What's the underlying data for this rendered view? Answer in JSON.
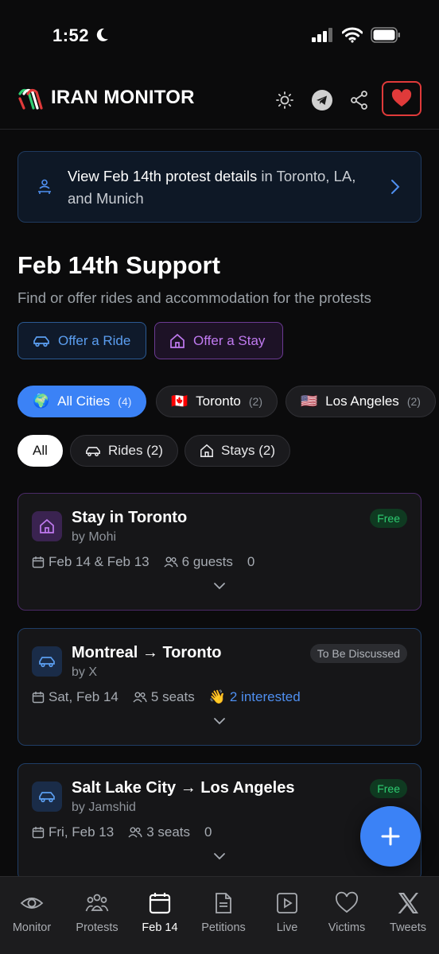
{
  "status_bar": {
    "time": "1:52"
  },
  "header": {
    "app_title": "IRAN MONITOR",
    "icons": [
      "sun-icon",
      "telegram-icon",
      "share-icon",
      "heart-icon"
    ]
  },
  "banner": {
    "bold": "View Feb 14th protest details",
    "rest": " in Toronto, LA, and Munich"
  },
  "page": {
    "title": "Feb 14th Support",
    "subtitle": "Find or offer rides and accommodation for the protests"
  },
  "actions": {
    "offer_ride": "Offer a Ride",
    "offer_stay": "Offer a Stay"
  },
  "city_filters": [
    {
      "flag": "🌍",
      "label": "All Cities",
      "count": "(4)",
      "active": true
    },
    {
      "flag": "🇨🇦",
      "label": "Toronto",
      "count": "(2)",
      "active": false
    },
    {
      "flag": "🇺🇸",
      "label": "Los Angeles",
      "count": "(2)",
      "active": false
    }
  ],
  "type_filters": {
    "all": "All",
    "rides": "Rides (2)",
    "stays": "Stays (2)"
  },
  "listings": [
    {
      "kind": "stay",
      "title": "Stay in Toronto",
      "by": "by Mohi",
      "badge": "Free",
      "date": "Feb 14 & Feb 13",
      "capacity": "6 guests",
      "interest": "0"
    },
    {
      "kind": "ride",
      "title": "Montreal → Toronto",
      "by": "by X",
      "badge": "To Be Discussed",
      "date": "Sat, Feb 14",
      "capacity": "5 seats",
      "interest_emoji": "👋",
      "interest": "2 interested"
    },
    {
      "kind": "ride",
      "title": "Salt Lake City → Los Angeles",
      "by": "by Jamshid",
      "badge": "Free",
      "date": "Fri, Feb 13",
      "capacity": "3 seats",
      "interest": "0"
    }
  ],
  "bottom_nav": [
    {
      "label": "Monitor",
      "icon": "eye-icon"
    },
    {
      "label": "Protests",
      "icon": "people-icon"
    },
    {
      "label": "Feb 14",
      "icon": "calendar-icon",
      "active": true
    },
    {
      "label": "Petitions",
      "icon": "document-icon"
    },
    {
      "label": "Live",
      "icon": "play-icon"
    },
    {
      "label": "Victims",
      "icon": "heart-outline-icon"
    },
    {
      "label": "Tweets",
      "icon": "x-logo-icon"
    }
  ],
  "colors": {
    "accent": "#3b82f6",
    "stay": "#c07af0",
    "free": "#2ecc71",
    "heart": "#e03a3a"
  }
}
